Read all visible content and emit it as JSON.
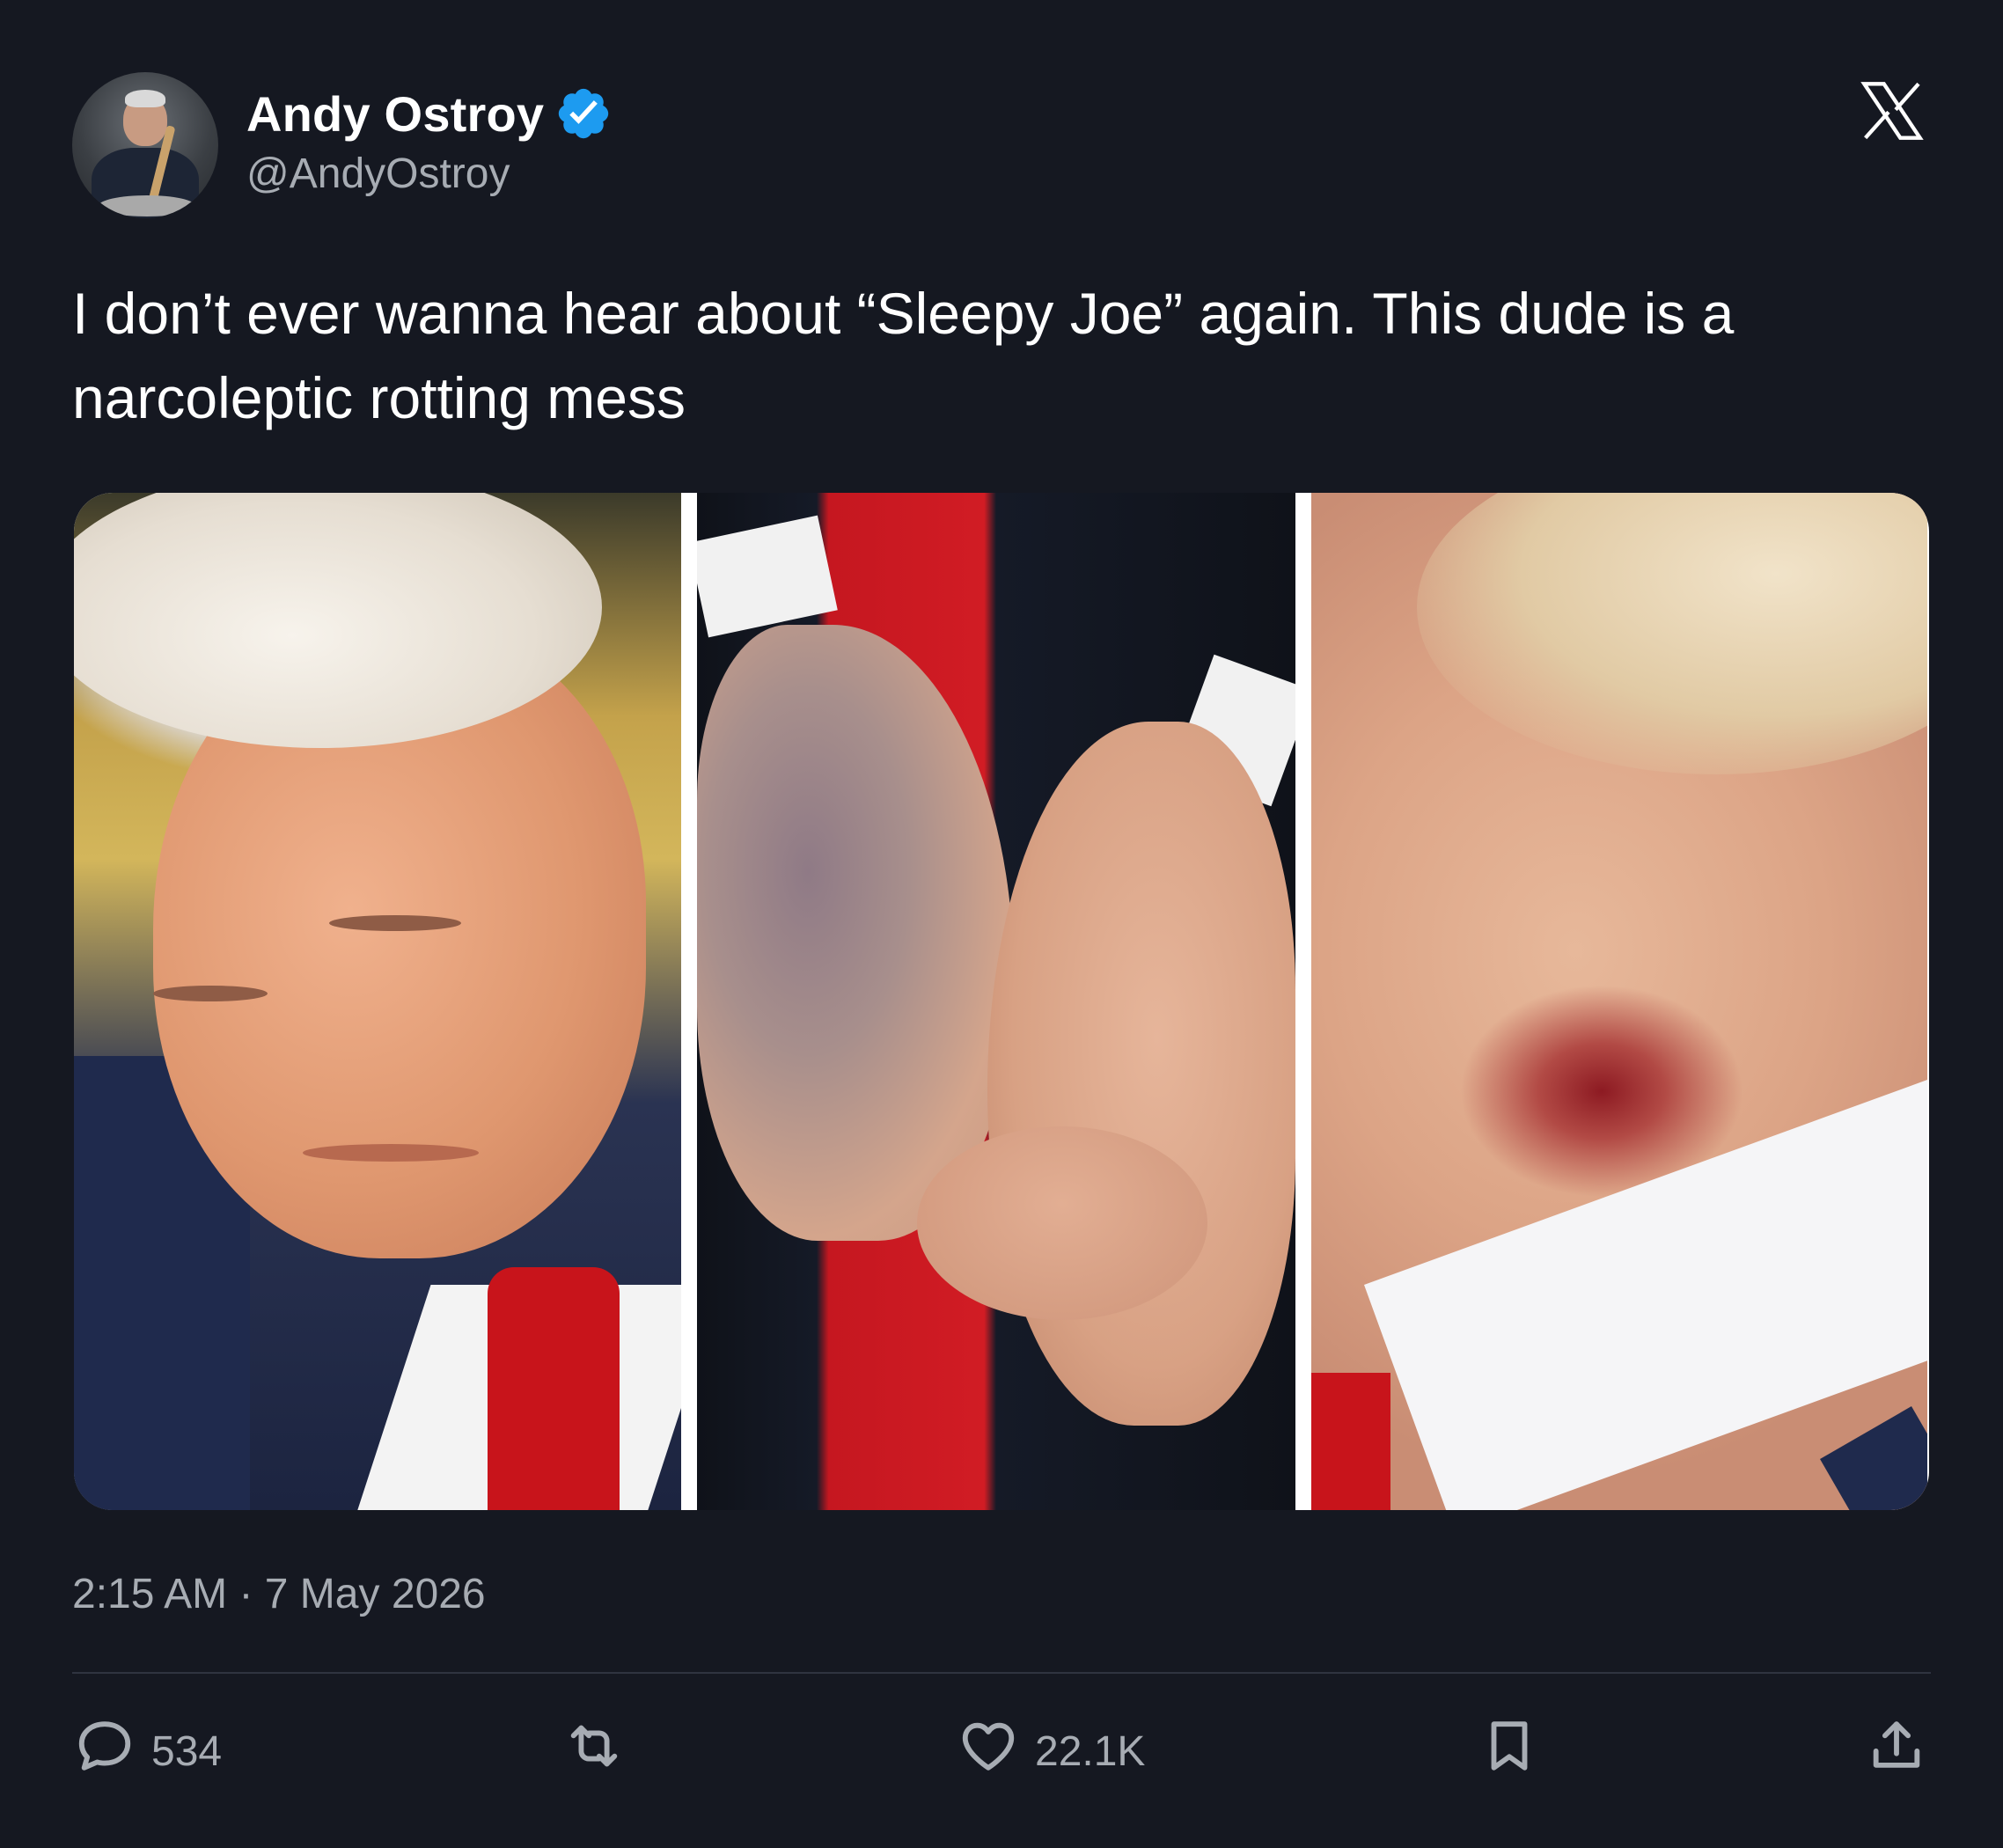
{
  "author": {
    "name": "Andy Ostroy",
    "handle": "@AndyOstroy",
    "verified": true
  },
  "tweet": {
    "text": "I don’t ever wanna hear about “Sleepy Joe” again. This dude is a narcoleptic rotting mess",
    "timestamp": "2:15 AM · 7 May 2026"
  },
  "metrics": {
    "replies": "534",
    "likes": "22.1K"
  },
  "icons": {
    "platform": "x-logo-icon",
    "verified": "verified-badge-icon",
    "reply": "reply-icon",
    "retweet": "retweet-icon",
    "like": "heart-icon",
    "bookmark": "bookmark-icon",
    "share": "share-icon"
  },
  "colors": {
    "background": "#151821",
    "verified_blue": "#1d9bf0",
    "secondary_text": "#a7acb3"
  }
}
